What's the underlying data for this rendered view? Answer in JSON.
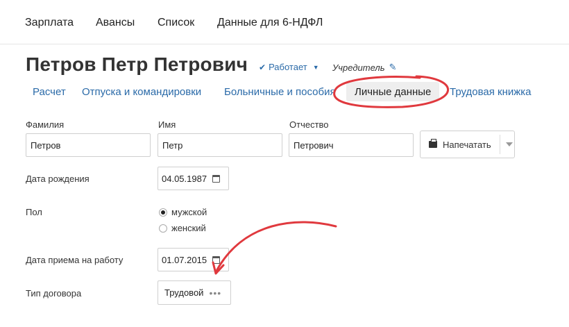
{
  "topnav": {
    "items": [
      {
        "label": "Зарплата"
      },
      {
        "label": "Авансы"
      },
      {
        "label": "Список"
      },
      {
        "label": "Данные для 6-НДФЛ"
      }
    ]
  },
  "employee": {
    "name": "Петров Петр Петрович",
    "status": "Работает",
    "role": "Учредитель"
  },
  "tabs": [
    {
      "label": "Расчет"
    },
    {
      "label": "Отпуска и командировки"
    },
    {
      "label": "Больничные и пособия"
    },
    {
      "label": "Личные данные",
      "active": true
    },
    {
      "label": "Трудовая книжка"
    }
  ],
  "form": {
    "surname": {
      "label": "Фамилия",
      "value": "Петров"
    },
    "firstname": {
      "label": "Имя",
      "value": "Петр"
    },
    "patronymic": {
      "label": "Отчество",
      "value": "Петрович"
    },
    "print_label": "Напечатать",
    "birthdate": {
      "label": "Дата рождения",
      "value": "04.05.1987"
    },
    "gender": {
      "label": "Пол",
      "options": [
        "мужской",
        "женский"
      ],
      "selected": "мужской"
    },
    "hire_date": {
      "label": "Дата приема на работу",
      "value": "01.07.2015"
    },
    "contract_type": {
      "label": "Тип договора",
      "value": "Трудовой"
    }
  },
  "colors": {
    "accent": "#2a6aa8",
    "annotation": "#e0393e"
  }
}
